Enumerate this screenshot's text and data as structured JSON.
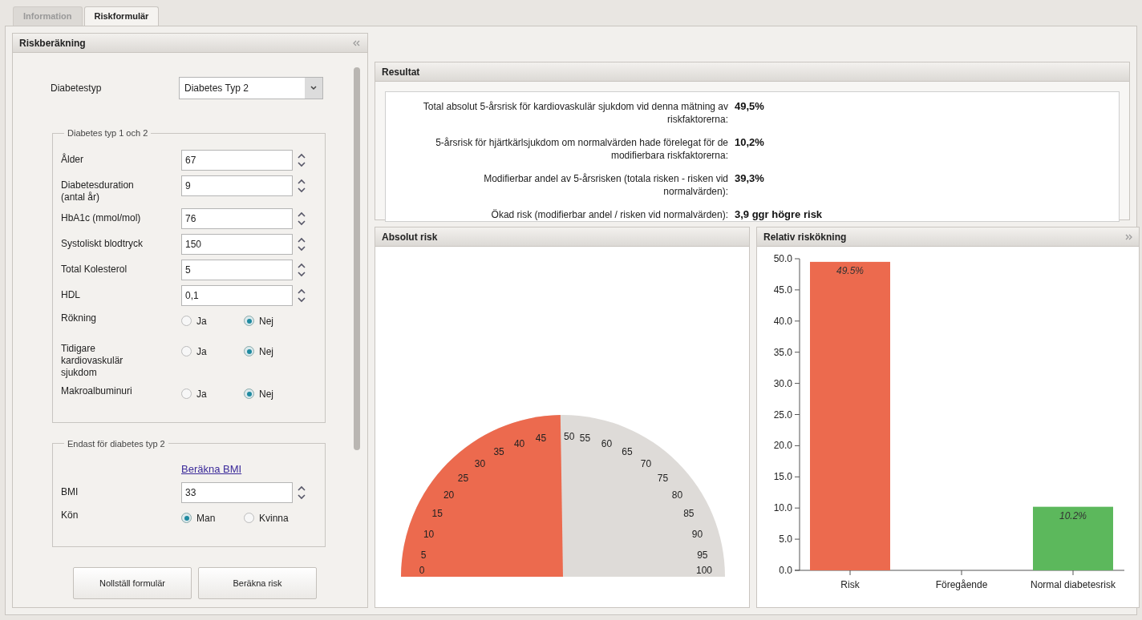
{
  "tabs": [
    {
      "label": "Information",
      "selected": false
    },
    {
      "label": "Riskformulär",
      "selected": true
    }
  ],
  "form_panel": {
    "title": "Riskberäkning",
    "diabetes_type": {
      "label": "Diabetestyp",
      "value": "Diabetes Typ 2"
    },
    "groups": [
      {
        "legend": "Diabetes typ 1 och 2",
        "fields": [
          {
            "kind": "number",
            "label": "Ålder",
            "value": "67"
          },
          {
            "kind": "number",
            "label": "Diabetesduration (antal år)",
            "value": "9"
          },
          {
            "kind": "number",
            "label": "HbA1c (mmol/mol)",
            "value": "76"
          },
          {
            "kind": "number",
            "label": "Systoliskt blodtryck",
            "value": "150"
          },
          {
            "kind": "number",
            "label": "Total Kolesterol",
            "value": "5"
          },
          {
            "kind": "number",
            "label": "HDL",
            "value": "0,1"
          },
          {
            "kind": "radio",
            "label": "Rökning",
            "options": [
              {
                "label": "Ja",
                "selected": false
              },
              {
                "label": "Nej",
                "selected": true
              }
            ]
          },
          {
            "kind": "radio",
            "label": "Tidigare kardiovaskulär sjukdom",
            "options": [
              {
                "label": "Ja",
                "selected": false
              },
              {
                "label": "Nej",
                "selected": true
              }
            ]
          },
          {
            "kind": "radio",
            "label": "Makroalbuminuri",
            "options": [
              {
                "label": "Ja",
                "selected": false
              },
              {
                "label": "Nej",
                "selected": true
              }
            ]
          }
        ]
      },
      {
        "legend": "Endast för diabetes typ 2",
        "fields": [
          {
            "kind": "link",
            "label": "Beräkna BMI"
          },
          {
            "kind": "number",
            "label": "BMI",
            "value": "33"
          },
          {
            "kind": "radio",
            "label": "Kön",
            "options": [
              {
                "label": "Man",
                "selected": true
              },
              {
                "label": "Kvinna",
                "selected": false
              }
            ]
          }
        ]
      }
    ],
    "buttons": [
      "Nollställ formulär",
      "Beräkna risk"
    ]
  },
  "results": {
    "title": "Resultat",
    "rows": [
      {
        "label": "Total absolut 5-årsrisk för kardiovaskulär sjukdom vid denna mätning av riskfaktorerna:",
        "value": "49,5%"
      },
      {
        "label": "5-årsrisk för hjärtkärlsjukdom om normalvärden hade förelegat för de modifierbara riskfaktorerna:",
        "value": "10,2%"
      },
      {
        "label": "Modifierbar andel av 5-årsrisken (totala risken - risken vid normalvärden):",
        "value": "39,3%"
      },
      {
        "label": "Ökad risk (modifierbar andel / risken vid normalvärden):",
        "value": "3,9 ggr högre risk"
      }
    ]
  },
  "absolute_risk": {
    "title": "Absolut risk",
    "level": 0.495,
    "ticks": [
      "0",
      "5",
      "10",
      "15",
      "20",
      "25",
      "30",
      "35",
      "40",
      "45",
      "50",
      "55",
      "60",
      "65",
      "70",
      "75",
      "80",
      "85",
      "90",
      "95",
      "100"
    ]
  },
  "relative_increase": {
    "title": "Relativ riskökning",
    "chart_data": {
      "type": "bar",
      "categories": [
        "Risk",
        "Föregående",
        "Normal diabetesrisk"
      ],
      "series": [
        {
          "color": "#ec6a4e",
          "values": [
            49.5,
            null,
            null
          ]
        },
        {
          "color": "#5cb85c",
          "values": [
            null,
            null,
            10.2
          ]
        }
      ],
      "ylim": [
        0,
        50
      ],
      "yticks": [
        {
          "value": 0,
          "label": "0.0"
        },
        {
          "value": 5,
          "label": "5.0"
        },
        {
          "value": 10,
          "label": "10.0"
        },
        {
          "value": 15,
          "label": "15.0"
        },
        {
          "value": 20,
          "label": "20.0"
        },
        {
          "value": 25,
          "label": "25.0"
        },
        {
          "value": 30,
          "label": "30.0"
        },
        {
          "value": 35,
          "label": "35.0"
        },
        {
          "value": 40,
          "label": "40.0"
        },
        {
          "value": 45,
          "label": "45.0"
        },
        {
          "value": 50,
          "label": "50.0"
        }
      ],
      "value_labels": [
        "49.5%",
        null,
        "10.2%"
      ]
    }
  }
}
